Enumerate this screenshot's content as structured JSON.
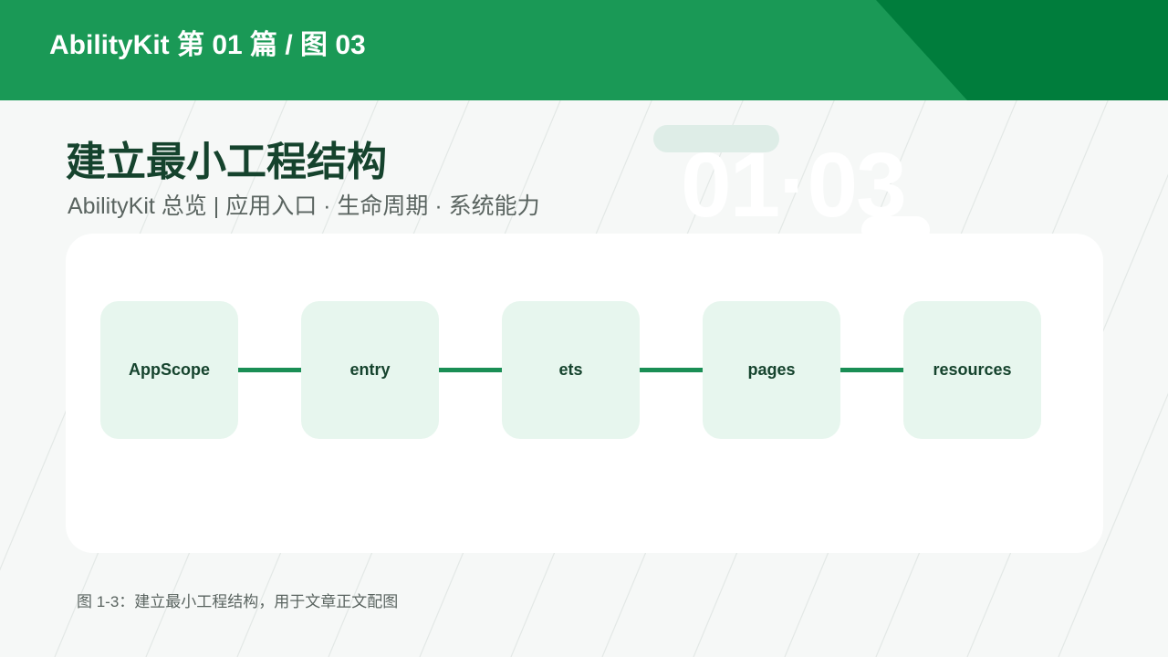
{
  "header": {
    "title": "AbilityKit 第 01 篇 / 图 03"
  },
  "watermark": {
    "number": "01·03"
  },
  "page": {
    "title": "建立最小工程结构",
    "subtitle": "AbilityKit 总览 | 应用入口 · 生命周期 · 系统能力"
  },
  "diagram": {
    "nodes": [
      {
        "label": "AppScope"
      },
      {
        "label": "entry"
      },
      {
        "label": "ets"
      },
      {
        "label": "pages"
      },
      {
        "label": "resources"
      }
    ]
  },
  "caption": "图 1-3：建立最小工程结构，用于文章正文配图",
  "colors": {
    "brand_green": "#1a9956",
    "dark_green": "#007d3c",
    "node_fill": "#e7f6ee",
    "connector": "#1a8e55",
    "title_text": "#15432d"
  }
}
